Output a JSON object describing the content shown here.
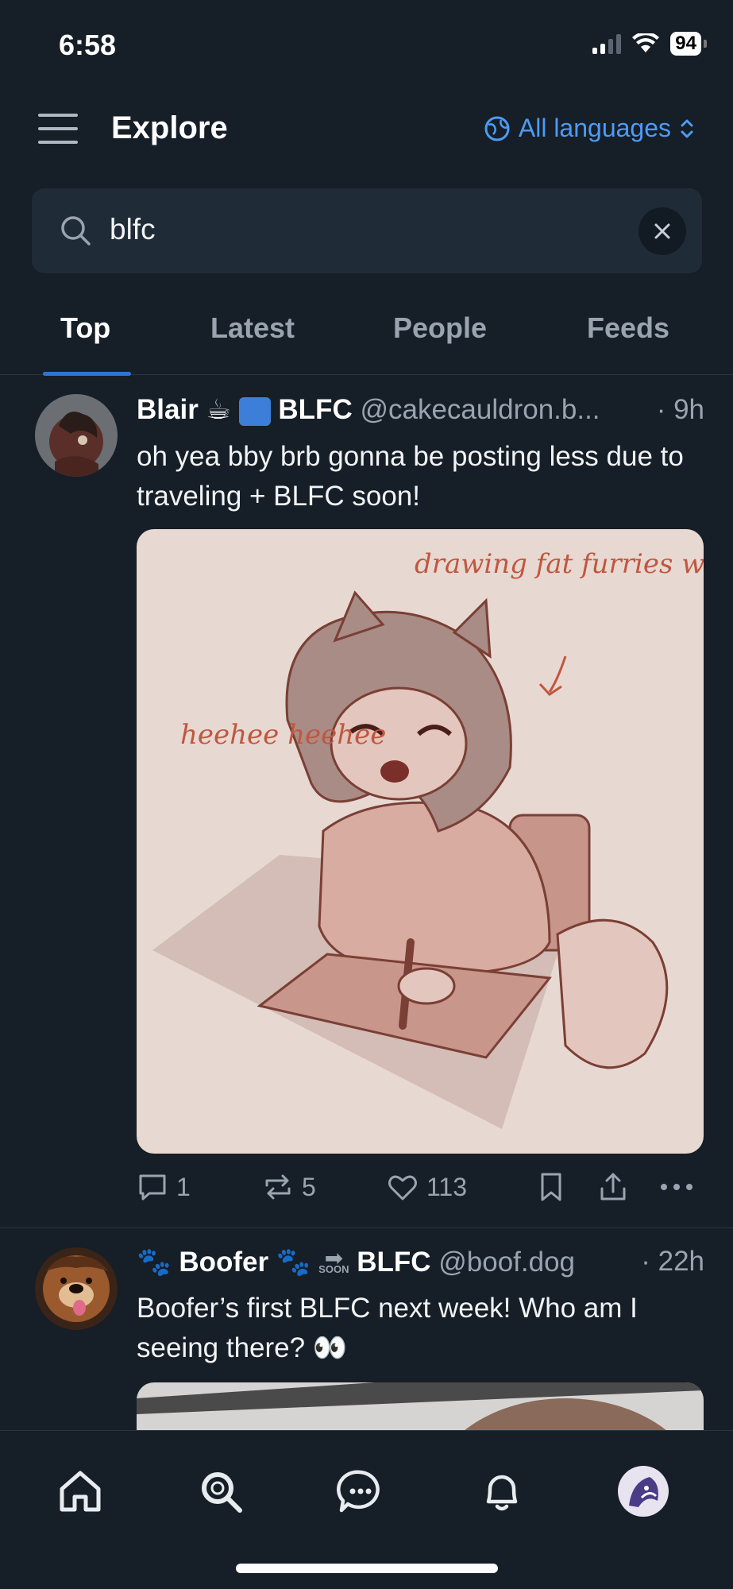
{
  "status_bar": {
    "time": "6:58",
    "battery": "94"
  },
  "header": {
    "title": "Explore",
    "language_label": "All languages"
  },
  "search": {
    "value": "blfc",
    "placeholder": "Search"
  },
  "tabs": [
    {
      "label": "Top",
      "active": true
    },
    {
      "label": "Latest",
      "active": false
    },
    {
      "label": "People",
      "active": false
    },
    {
      "label": "Feeds",
      "active": false
    }
  ],
  "posts": [
    {
      "author": "Blair",
      "author_suffix": "BLFC",
      "handle": "@cakecauldron.b...",
      "time": "· 9h",
      "text": "oh yea bby brb gonna be posting less due to traveling + BLFC soon!",
      "image_text": {
        "caption_top": "drawing fat furries with huge bellies",
        "caption_left": "heehee heehee"
      },
      "actions": {
        "replies": "1",
        "reposts": "5",
        "likes": "113"
      }
    },
    {
      "author": "Boofer",
      "author_suffix": "BLFC",
      "soon_label": "SOON",
      "handle": "@boof.dog",
      "time": "· 22h",
      "text": "Boofer’s first BLFC next week! Who am I seeing there? 👀"
    }
  ],
  "colors": {
    "accent": "#4c9cf5",
    "background": "#161e27",
    "surface": "#202b38"
  }
}
